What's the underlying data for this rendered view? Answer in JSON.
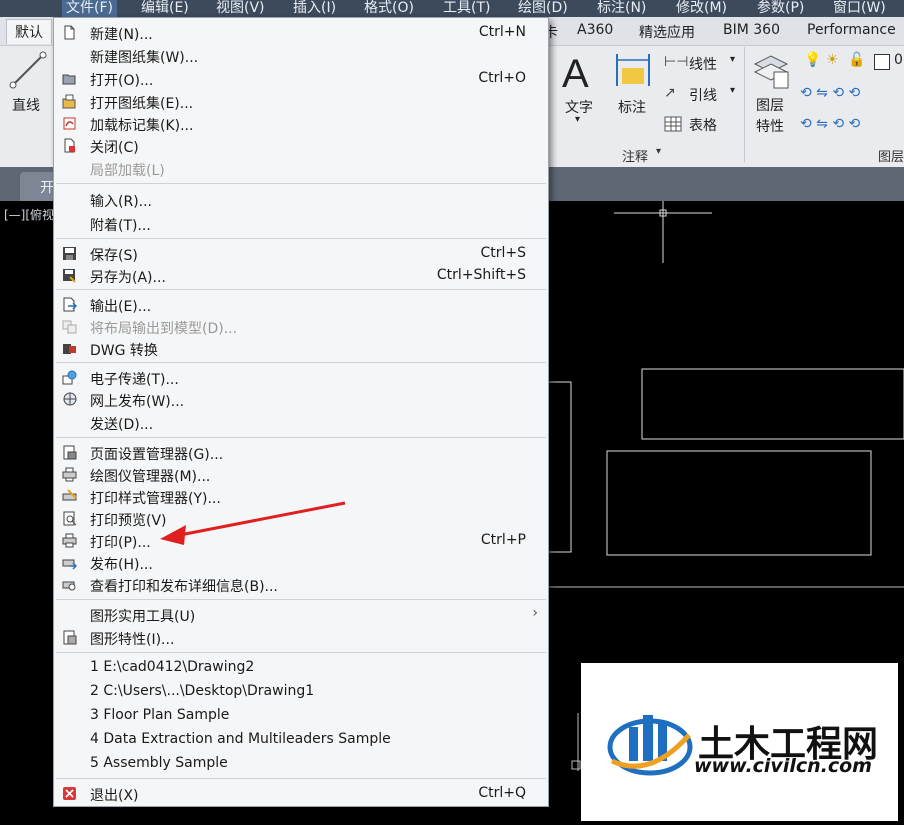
{
  "menubar": {
    "items": [
      "文件(F)",
      "编辑(E)",
      "视图(V)",
      "插入(I)",
      "格式(O)",
      "工具(T)",
      "绘图(D)",
      "标注(N)",
      "修改(M)",
      "参数(P)",
      "窗口(W)"
    ]
  },
  "ribbon": {
    "tabs": [
      "默认",
      "A360",
      "精选应用",
      "BIM 360",
      "Performance"
    ],
    "line_tool": "直线",
    "text_tool": "文字",
    "dim_tool": "标注",
    "linear": "线性",
    "leader": "引线",
    "table": "表格",
    "layer_props_1": "图层",
    "layer_props_2": "特性",
    "annotation_panel": "注释",
    "layer_panel": "图层",
    "file_tab": "开"
  },
  "viewport": {
    "label": "[—][俯视]"
  },
  "menu": {
    "items": [
      {
        "label": "新建(N)...",
        "shortcut": "Ctrl+N"
      },
      {
        "label": "新建图纸集(W)...",
        "shortcut": ""
      },
      {
        "label": "打开(O)...",
        "shortcut": "Ctrl+O"
      },
      {
        "label": "打开图纸集(E)...",
        "shortcut": ""
      },
      {
        "label": "加载标记集(K)...",
        "shortcut": ""
      },
      {
        "label": "关闭(C)",
        "shortcut": ""
      },
      {
        "label": "局部加载(L)",
        "shortcut": ""
      },
      {
        "label": "输入(R)...",
        "shortcut": ""
      },
      {
        "label": "附着(T)...",
        "shortcut": ""
      },
      {
        "label": "保存(S)",
        "shortcut": "Ctrl+S"
      },
      {
        "label": "另存为(A)...",
        "shortcut": "Ctrl+Shift+S"
      },
      {
        "label": "输出(E)...",
        "shortcut": ""
      },
      {
        "label": "将布局输出到模型(D)...",
        "shortcut": ""
      },
      {
        "label": "DWG 转换",
        "shortcut": ""
      },
      {
        "label": "电子传递(T)...",
        "shortcut": ""
      },
      {
        "label": "网上发布(W)...",
        "shortcut": ""
      },
      {
        "label": "发送(D)...",
        "shortcut": ""
      },
      {
        "label": "页面设置管理器(G)...",
        "shortcut": ""
      },
      {
        "label": "绘图仪管理器(M)...",
        "shortcut": ""
      },
      {
        "label": "打印样式管理器(Y)...",
        "shortcut": ""
      },
      {
        "label": "打印预览(V)",
        "shortcut": ""
      },
      {
        "label": "打印(P)...",
        "shortcut": "Ctrl+P"
      },
      {
        "label": "发布(H)...",
        "shortcut": ""
      },
      {
        "label": "查看打印和发布详细信息(B)...",
        "shortcut": ""
      },
      {
        "label": "图形实用工具(U)",
        "shortcut": ""
      },
      {
        "label": "图形特性(I)...",
        "shortcut": ""
      },
      {
        "label": "1 E:\\cad0412\\Drawing2",
        "shortcut": ""
      },
      {
        "label": "2 C:\\Users\\...\\Desktop\\Drawing1",
        "shortcut": ""
      },
      {
        "label": "3 Floor Plan Sample",
        "shortcut": ""
      },
      {
        "label": "4 Data Extraction and Multileaders Sample",
        "shortcut": ""
      },
      {
        "label": "5 Assembly Sample",
        "shortcut": ""
      },
      {
        "label": "退出(X)",
        "shortcut": "Ctrl+Q"
      }
    ]
  },
  "watermark": {
    "brand": "土木工程网",
    "url": "www.civilcn.com"
  },
  "colors": {
    "accent": "#e02020",
    "menu_bg": "#f5f6f7",
    "menubar_bg": "#3d4a5c"
  }
}
